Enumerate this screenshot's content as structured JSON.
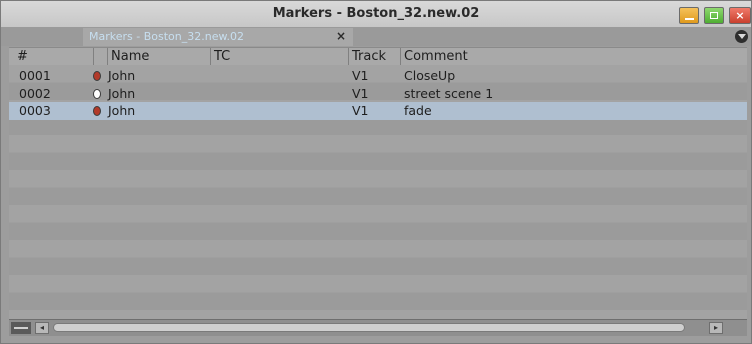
{
  "window": {
    "title": "Markers - Boston_32.new.02"
  },
  "tab": {
    "label": "Markers - Boston_32.new.02",
    "close_glyph": "×"
  },
  "columns": {
    "num": "#",
    "name": "Name",
    "tc": "TC",
    "track": "Track",
    "comment": "Comment"
  },
  "rows": [
    {
      "num": "0001",
      "marker_color": "#b23a2a",
      "name": "John",
      "tc": "",
      "track": "V1",
      "comment": "CloseUp",
      "selected": false
    },
    {
      "num": "0002",
      "marker_color": "#ffffff",
      "name": "John",
      "tc": "",
      "track": "V1",
      "comment": "street scene 1",
      "selected": false
    },
    {
      "num": "0003",
      "marker_color": "#b23a2a",
      "name": "John",
      "tc": "",
      "track": "V1",
      "comment": "fade",
      "selected": true
    }
  ],
  "colors": {
    "selection": "#afbfd0",
    "tab_text": "#c7dff0"
  },
  "icons": [
    "minimize-icon",
    "maximize-icon",
    "close-icon",
    "fast-menu-icon",
    "marker-dot-icon",
    "scroll-left-icon",
    "scroll-right-icon"
  ]
}
